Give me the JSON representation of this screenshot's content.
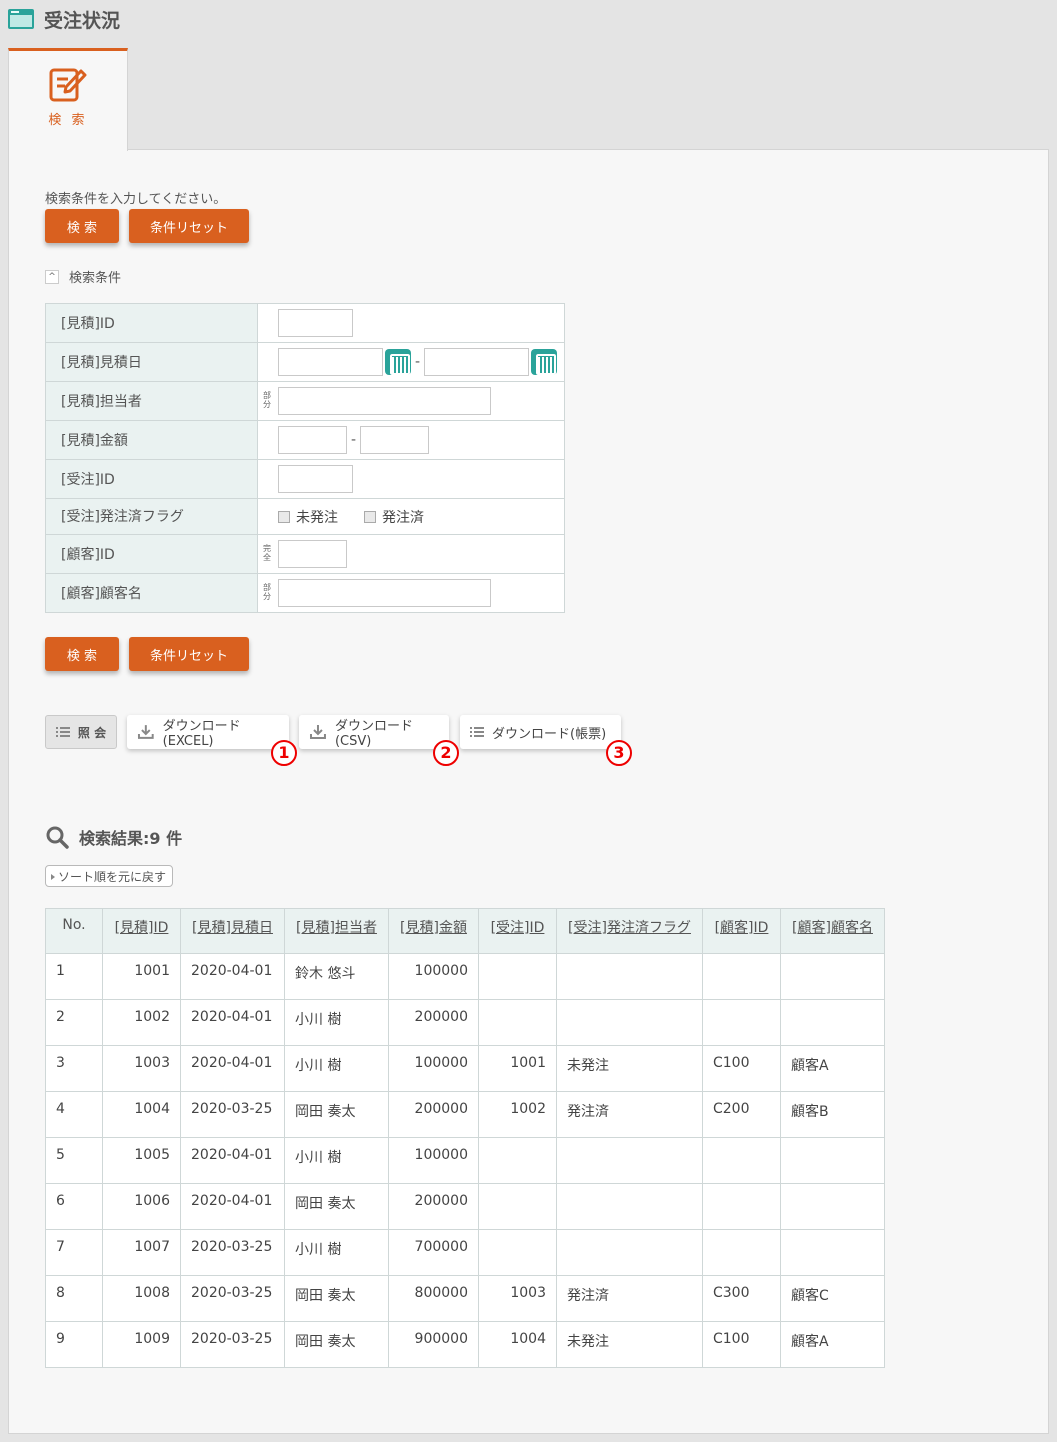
{
  "page": {
    "title": "受注状況"
  },
  "tab": {
    "label": "検 索"
  },
  "search": {
    "hint": "検索条件を入力してください。",
    "search_label": "検 索",
    "reset_label": "条件リセット",
    "conditions_toggle": "検索条件",
    "fields": {
      "mitsumori_id": "[見積]ID",
      "mitsumori_date": "[見積]見積日",
      "mitsumori_tanto": "[見積]担当者",
      "mitsumori_kingaku": "[見積]金額",
      "juchu_id": "[受注]ID",
      "juchu_flag": "[受注]発注済フラグ",
      "kokyaku_id": "[顧客]ID",
      "kokyaku_name": "[顧客]顧客名"
    },
    "partial_tag": "部分",
    "exact_tag": "完全",
    "range_sep": "-",
    "flag_options": [
      "未発注",
      "発注済"
    ]
  },
  "actions": {
    "view_label": "照 会",
    "dl_excel": "ダウンロード(EXCEL)",
    "dl_csv": "ダウンロード(CSV)",
    "dl_report": "ダウンロード(帳票)",
    "markers": [
      "1",
      "2",
      "3"
    ]
  },
  "results": {
    "title": "検索結果:9 件",
    "sort_reset": "ソート順を元に戻す",
    "headers": [
      "No.",
      "[見積]ID",
      "[見積]見積日",
      "[見積]担当者",
      "[見積]金額",
      "[受注]ID",
      "[受注]発注済フラグ",
      "[顧客]ID",
      "[顧客]顧客名"
    ],
    "rows": [
      [
        "1",
        "1001",
        "2020-04-01",
        "鈴木 悠斗",
        "100000",
        "",
        "",
        "",
        ""
      ],
      [
        "2",
        "1002",
        "2020-04-01",
        "小川 樹",
        "200000",
        "",
        "",
        "",
        ""
      ],
      [
        "3",
        "1003",
        "2020-04-01",
        "小川 樹",
        "100000",
        "1001",
        "未発注",
        "C100",
        "顧客A"
      ],
      [
        "4",
        "1004",
        "2020-03-25",
        "岡田 奏太",
        "200000",
        "1002",
        "発注済",
        "C200",
        "顧客B"
      ],
      [
        "5",
        "1005",
        "2020-04-01",
        "小川 樹",
        "100000",
        "",
        "",
        "",
        ""
      ],
      [
        "6",
        "1006",
        "2020-04-01",
        "岡田 奏太",
        "200000",
        "",
        "",
        "",
        ""
      ],
      [
        "7",
        "1007",
        "2020-03-25",
        "小川 樹",
        "700000",
        "",
        "",
        "",
        ""
      ],
      [
        "8",
        "1008",
        "2020-03-25",
        "岡田 奏太",
        "800000",
        "1003",
        "発注済",
        "C300",
        "顧客C"
      ],
      [
        "9",
        "1009",
        "2020-03-25",
        "岡田 奏太",
        "900000",
        "1004",
        "未発注",
        "C100",
        "顧客A"
      ]
    ]
  },
  "colors": {
    "accent": "#d9601f",
    "teal": "#2aa39a",
    "header_bg": "#eaf2f1",
    "marker": "#e00000"
  }
}
